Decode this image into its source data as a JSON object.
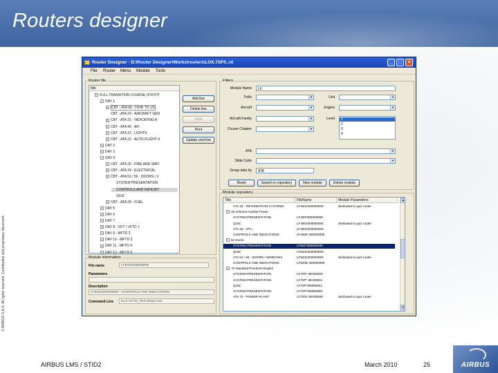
{
  "slide": {
    "title": "Routers designer",
    "copyright": "© AIRBUS S.A.S. All rights reserved. Confidential and proprietary document.",
    "footer_left": "AIRBUS LMS / STID2",
    "footer_date": "March 2010",
    "footer_page": "25",
    "logo_text": "AIRBUS"
  },
  "window": {
    "title": "Router Designer - D:\\Router Designer\\Works\\routers\\LOX.7SF0..rd",
    "buttons": {
      "minimize": "_",
      "maximize": "□",
      "close": "×"
    },
    "menu": [
      "File",
      "Router",
      "Menu",
      "Module",
      "Tools"
    ]
  },
  "router_file": {
    "group_label": "Router file",
    "column_header": "title",
    "tree": [
      {
        "label": "FULL TRANSITION COURSE (FOOTP",
        "toggle": "−"
      },
      {
        "label": "DAY 1",
        "toggle": "−"
      },
      {
        "label": "CBT - ATA 00 - HOW TO US",
        "toggle": "−",
        "selected": true
      },
      {
        "label": "CBT - ATA 20 - AIRCRAFT GEN",
        "toggle": ""
      },
      {
        "label": "CBT - ATA 31 - INDICATING A",
        "toggle": "+"
      },
      {
        "label": "CBT - ATA 45 - AFI",
        "toggle": "+"
      },
      {
        "label": "CBT - ATA 22 - LIGHTS",
        "toggle": "+"
      },
      {
        "label": "CBT - ATA 22 - AUTO FLIGHT S",
        "toggle": "+"
      },
      {
        "label": "DAY 2",
        "toggle": "+"
      },
      {
        "label": "DAY 3",
        "toggle": "+"
      },
      {
        "label": "DAY 4",
        "toggle": "−"
      },
      {
        "label": "CBT - ATA 26 - FIRE AND SMO",
        "toggle": "+"
      },
      {
        "label": "CBT - ATA 24 - ELECTRICAL",
        "toggle": "+"
      },
      {
        "label": "CBT - ATA 52 / 56 - DOORS / V",
        "toggle": "−"
      },
      {
        "label": "SYSTEM PRESENTATION",
        "toggle": ""
      },
      {
        "label": "CONTROLS AND INDICATI",
        "toggle": "",
        "highlight": true
      },
      {
        "label": "QUIZ",
        "toggle": ""
      },
      {
        "label": "CBT - ATA 28 - FUEL",
        "toggle": "+"
      },
      {
        "label": "DAY 5",
        "toggle": "+"
      },
      {
        "label": "DAY 6",
        "toggle": "+"
      },
      {
        "label": "DAY 7",
        "toggle": "+"
      },
      {
        "label": "DAY 8 - OFT / VFTD 1",
        "toggle": "+"
      },
      {
        "label": "DAY 9 - MFTD 2",
        "toggle": "+"
      },
      {
        "label": "DAY 10 - MFTD 3",
        "toggle": "+"
      },
      {
        "label": "DAY 11 - MFTD 4",
        "toggle": "+"
      },
      {
        "label": "DAY 12 - MFTD 5",
        "toggle": "+"
      }
    ],
    "buttons": [
      "Add line",
      "Delete line",
      "Undo",
      "Print",
      "Update cmd line"
    ]
  },
  "filters": {
    "group_label": "Filters",
    "module_name_label": "Module Name",
    "module_name_value": "LF",
    "trolls_label": "Trolls",
    "unit_label": "Unit",
    "aircraft_label": "Aircraft",
    "engine_label": "Engine",
    "aircraft_family_label": "Aircraft Family",
    "level_label": "Level",
    "level_options": [
      "1",
      "2",
      "3",
      "4"
    ],
    "course_chapter_label": "Course Chapter",
    "ata_label": "ATA",
    "slide_code_label": "Slide Code",
    "group_data_by_label": "Group data by",
    "group_data_by_value": "ATA",
    "buttons": [
      "Reset",
      "Search in repository",
      "New module",
      "Delete module"
    ]
  },
  "module_repository": {
    "group_label": "Module repository",
    "columns": [
      "Title",
      "FileName",
      "Module Parameters"
    ],
    "rows": [
      {
        "title": "ATA 46 - INFORMATION SYSTEMS",
        "file": "LF4601000000000",
        "params": "dedicated to quiz router",
        "indent": 2,
        "toggle": ""
      },
      {
        "title": "49   Airborne Auxiliar Power",
        "file": "",
        "params": "",
        "indent": 1,
        "toggle": "−"
      },
      {
        "title": "SYSTEM PRESENTATION",
        "file": "LF490*000000000",
        "params": "",
        "indent": 2,
        "toggle": ""
      },
      {
        "title": "QUIZ",
        "file": "LF4901000000000",
        "params": "dedicated to quiz router",
        "indent": 2,
        "toggle": ""
      },
      {
        "title": "ATA 49 - APU",
        "file": "LF4901000000000",
        "params": "",
        "indent": 2,
        "toggle": ""
      },
      {
        "title": "CONTROLS AND INDICATIONS",
        "file": "LF490E 000000000",
        "params": "",
        "indent": 2,
        "toggle": ""
      },
      {
        "title": "52   Doors",
        "file": "",
        "params": "",
        "indent": 1,
        "toggle": "−"
      },
      {
        "title": "SYSTEM PRESENTATION",
        "file": "LF520*000000000",
        "params": "",
        "indent": 2,
        "toggle": "",
        "selected": true
      },
      {
        "title": "QUIZ",
        "file": "LF5201000000000",
        "params": "",
        "indent": 2,
        "toggle": ""
      },
      {
        "title": "ATA 52 / 56 - DOORS / WINDOWS",
        "file": "LF5201000000000",
        "params": "dedicated to quiz router",
        "indent": 2,
        "toggle": ""
      },
      {
        "title": "CONTROLS AND INDICATIONS",
        "file": "LF520E 000000000",
        "params": "",
        "indent": 2,
        "toggle": ""
      },
      {
        "title": "70   Standard Practices-Engine",
        "file": "",
        "params": "",
        "indent": 1,
        "toggle": "−"
      },
      {
        "title": "SYSTEM PRESENTATION",
        "file": "LF70P* 0E000000",
        "params": "",
        "indent": 2,
        "toggle": ""
      },
      {
        "title": "SYSTEM PRESENTATION",
        "file": "LF70P* 0EJ00001",
        "params": "",
        "indent": 2,
        "toggle": ""
      },
      {
        "title": "QUIZ",
        "file": "LF70P*0M000001",
        "params": "",
        "indent": 2,
        "toggle": ""
      },
      {
        "title": "SYSTEM PRESENTATION",
        "file": "LF70P*0M000000",
        "params": "",
        "indent": 2,
        "toggle": ""
      },
      {
        "title": "ATA 70 - POWER PLANT",
        "file": "LF7001 0E000000",
        "params": "dedicated to quiz router",
        "indent": 2,
        "toggle": ""
      }
    ]
  },
  "module_information": {
    "group_label": "Module information",
    "file_name_label": "File name",
    "file_name_value": "LF5201000000000",
    "parameters_label": "Parameters",
    "parameters_value": "",
    "description_label": "Description",
    "description_value": "LF5201000000000 - CONTROLS AND INDICATIONS",
    "command_line_label": "Command Line",
    "command_line_value": "ta=6 XCTN_Text-viewer.exe"
  }
}
